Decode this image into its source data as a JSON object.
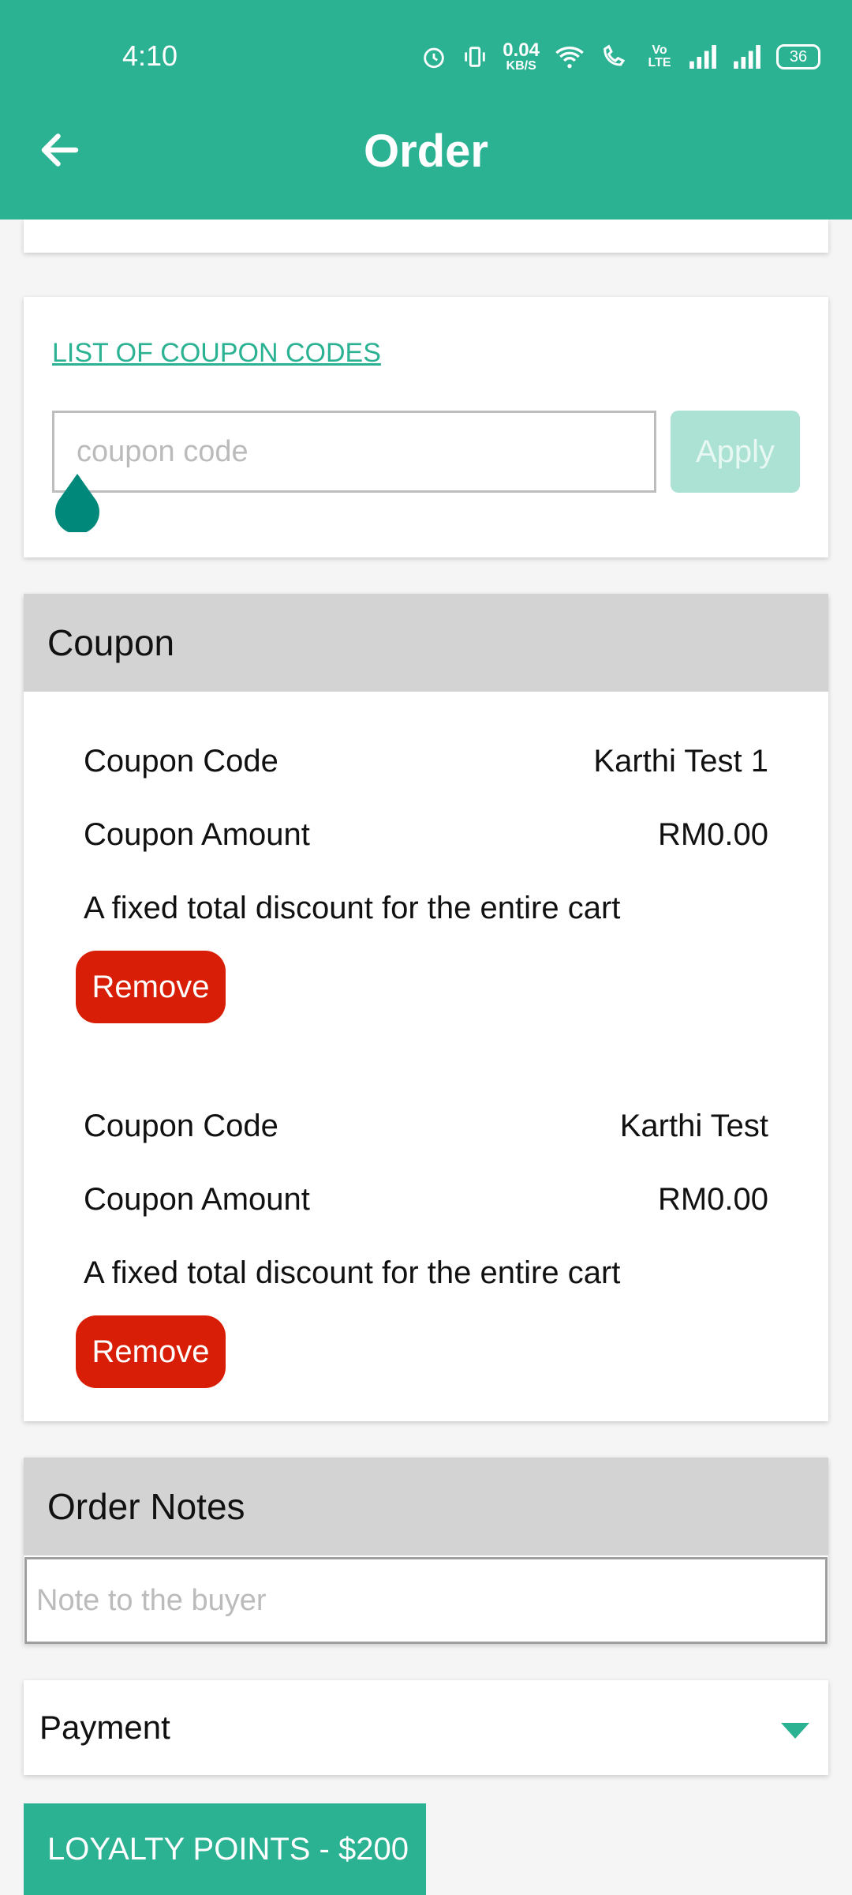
{
  "status_bar": {
    "time": "4:10",
    "net_speed": "0.04",
    "net_unit": "KB/S",
    "volte": "Vo LTE",
    "battery": "36"
  },
  "header": {
    "title": "Order"
  },
  "coupon_entry": {
    "list_link": "LIST OF COUPON CODES",
    "placeholder": "coupon code",
    "apply_label": "Apply"
  },
  "coupon_section": {
    "title": "Coupon",
    "items": [
      {
        "code_label": "Coupon Code",
        "code_value": "Karthi Test 1",
        "amount_label": "Coupon Amount",
        "amount_value": "RM0.00",
        "description": "A fixed total discount for the entire cart",
        "remove_label": "Remove"
      },
      {
        "code_label": "Coupon Code",
        "code_value": "Karthi Test",
        "amount_label": "Coupon Amount",
        "amount_value": "RM0.00",
        "description": "A fixed total discount for the entire cart",
        "remove_label": "Remove"
      }
    ]
  },
  "order_notes": {
    "title": "Order Notes",
    "placeholder": "Note to the buyer"
  },
  "payment": {
    "label": "Payment"
  },
  "loyalty": {
    "label": "LOYALTY POINTS - $200"
  },
  "colors": {
    "primary": "#2bb292",
    "apply_disabled": "#abe2d4",
    "remove": "#d81e06",
    "section_header": "#d3d3d3",
    "cursor_handle": "#00897b"
  }
}
